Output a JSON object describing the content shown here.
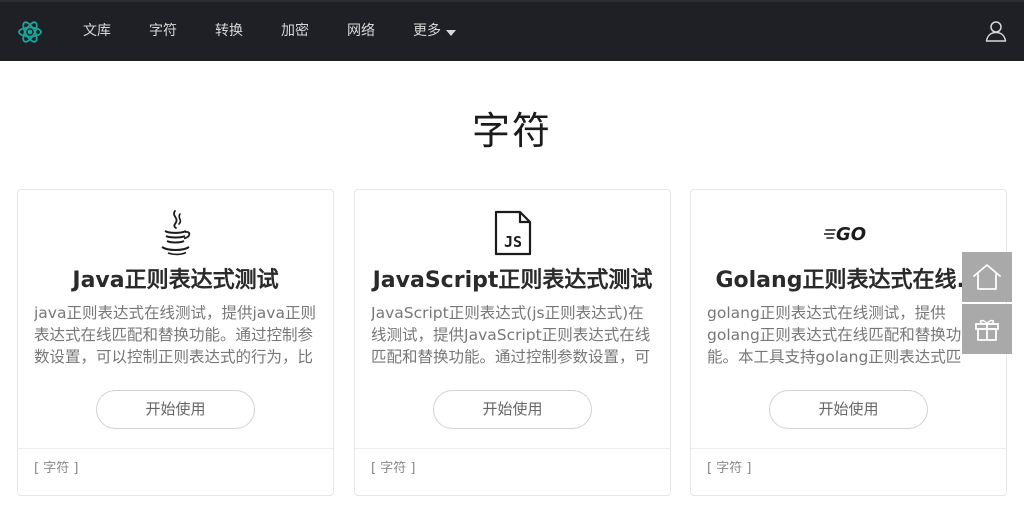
{
  "nav": {
    "items": [
      "文库",
      "字符",
      "转换",
      "加密",
      "网络"
    ],
    "more_label": "更多"
  },
  "page": {
    "title": "字符"
  },
  "cards": [
    {
      "title": "Java正则表达式测试",
      "desc": "java正则表达式在线测试，提供java正则表达式在线匹配和替换功能。通过控制参数设置，可以控制正则表达式的行为，比如忽略大小写，多行模式等。",
      "button": "开始使用",
      "tag": "[ 字符 ]"
    },
    {
      "title": "JavaScript正则表达式测试",
      "desc": "JavaScript正则表达式(js正则表达式)在线测试，提供JavaScript正则表达式在线匹配和替换功能。通过控制参数设置，可以控制正则表达式的行为，比如",
      "button": "开始使用",
      "tag": "[ 字符 ]"
    },
    {
      "title": "Golang正则表达式在线...",
      "desc": "golang正则表达式在线测试，提供golang正则表达式在线匹配和替换功能。本工具支持golang正则表达式匹配，golang正则表达式拆分字符串",
      "button": "开始使用",
      "tag": "[ 字符 ]"
    }
  ],
  "icons": {
    "logo": "atom-logo-icon",
    "user": "user-icon",
    "card_icons": [
      "java-coffee-icon",
      "js-file-icon",
      "go-logo-icon"
    ],
    "side": [
      "home-icon",
      "gift-icon"
    ]
  },
  "colors": {
    "nav_bg": "#1f1f26",
    "logo_accent": "#1aa59a",
    "side_button_bg": "#a9a9a9"
  }
}
